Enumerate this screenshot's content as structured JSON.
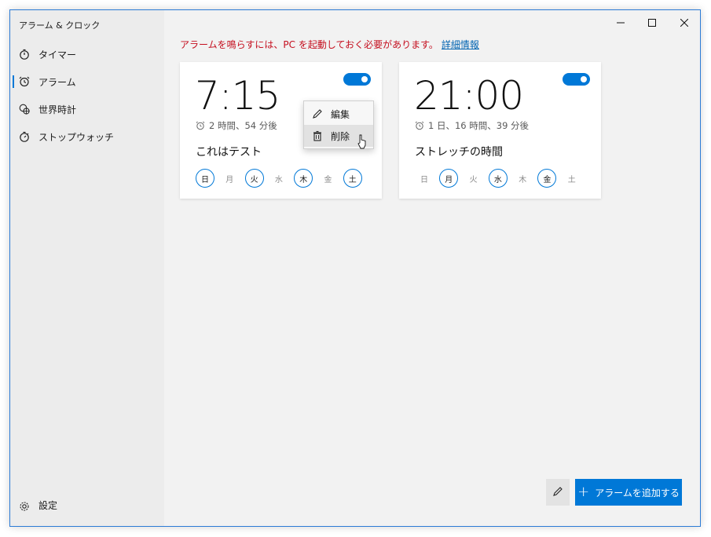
{
  "window": {
    "title": "アラーム & クロック",
    "minimize_icon": "minimize-icon",
    "maximize_icon": "maximize-icon",
    "close_icon": "close-icon"
  },
  "sidebar": {
    "items": [
      {
        "label": "タイマー",
        "icon": "timer-icon"
      },
      {
        "label": "アラーム",
        "icon": "alarm-clock-icon",
        "active": true
      },
      {
        "label": "世界時計",
        "icon": "globe-clock-icon"
      },
      {
        "label": "ストップウォッチ",
        "icon": "stopwatch-icon"
      }
    ],
    "settings_label": "設定"
  },
  "warning": {
    "text": "アラームを鳴らすには、PC を起動しておく必要があります。",
    "link": "詳細情報"
  },
  "alarms": [
    {
      "time": "7:15",
      "remaining": "2 時間、54 分後",
      "name": "これはテスト",
      "enabled": true,
      "days": [
        {
          "label": "日",
          "on": true
        },
        {
          "label": "月",
          "on": false
        },
        {
          "label": "火",
          "on": true
        },
        {
          "label": "水",
          "on": false
        },
        {
          "label": "木",
          "on": true
        },
        {
          "label": "金",
          "on": false
        },
        {
          "label": "土",
          "on": true
        }
      ]
    },
    {
      "time": "21:00",
      "remaining": "1 日、16 時間、39 分後",
      "name": "ストレッチの時間",
      "enabled": true,
      "days": [
        {
          "label": "日",
          "on": false
        },
        {
          "label": "月",
          "on": true
        },
        {
          "label": "火",
          "on": false
        },
        {
          "label": "水",
          "on": true
        },
        {
          "label": "木",
          "on": false
        },
        {
          "label": "金",
          "on": true
        },
        {
          "label": "土",
          "on": false
        }
      ]
    }
  ],
  "context_menu": {
    "edit_label": "編集",
    "delete_label": "削除"
  },
  "footer": {
    "add_label": "アラームを追加する"
  },
  "colors": {
    "accent": "#0078d7",
    "warning": "#c50f1f",
    "link": "#0063b1"
  }
}
